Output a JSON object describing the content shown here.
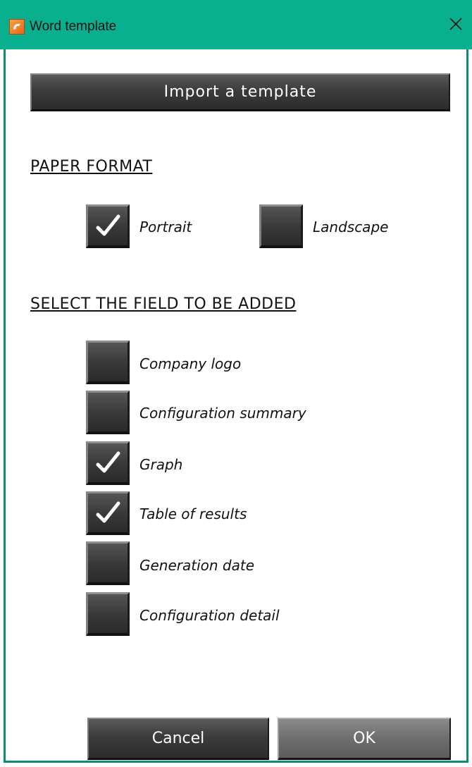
{
  "window": {
    "title": "Word template",
    "accent_color": "#08b08f",
    "app_icon": "app-logo-icon",
    "close_icon": "close-icon"
  },
  "toolbar": {
    "import_label": "Import a template"
  },
  "paper_format": {
    "heading": "PAPER FORMAT",
    "options": [
      {
        "label": "Portrait",
        "checked": true
      },
      {
        "label": "Landscape",
        "checked": false
      }
    ]
  },
  "fields": {
    "heading": "SELECT THE FIELD TO BE ADDED",
    "items": [
      {
        "label": "Company logo",
        "checked": false
      },
      {
        "label": "Configuration summary",
        "checked": false
      },
      {
        "label": "Graph",
        "checked": true
      },
      {
        "label": "Table of results",
        "checked": true
      },
      {
        "label": "Generation date",
        "checked": false
      },
      {
        "label": "Configuration detail",
        "checked": false
      }
    ]
  },
  "footer": {
    "cancel_label": "Cancel",
    "ok_label": "OK"
  }
}
